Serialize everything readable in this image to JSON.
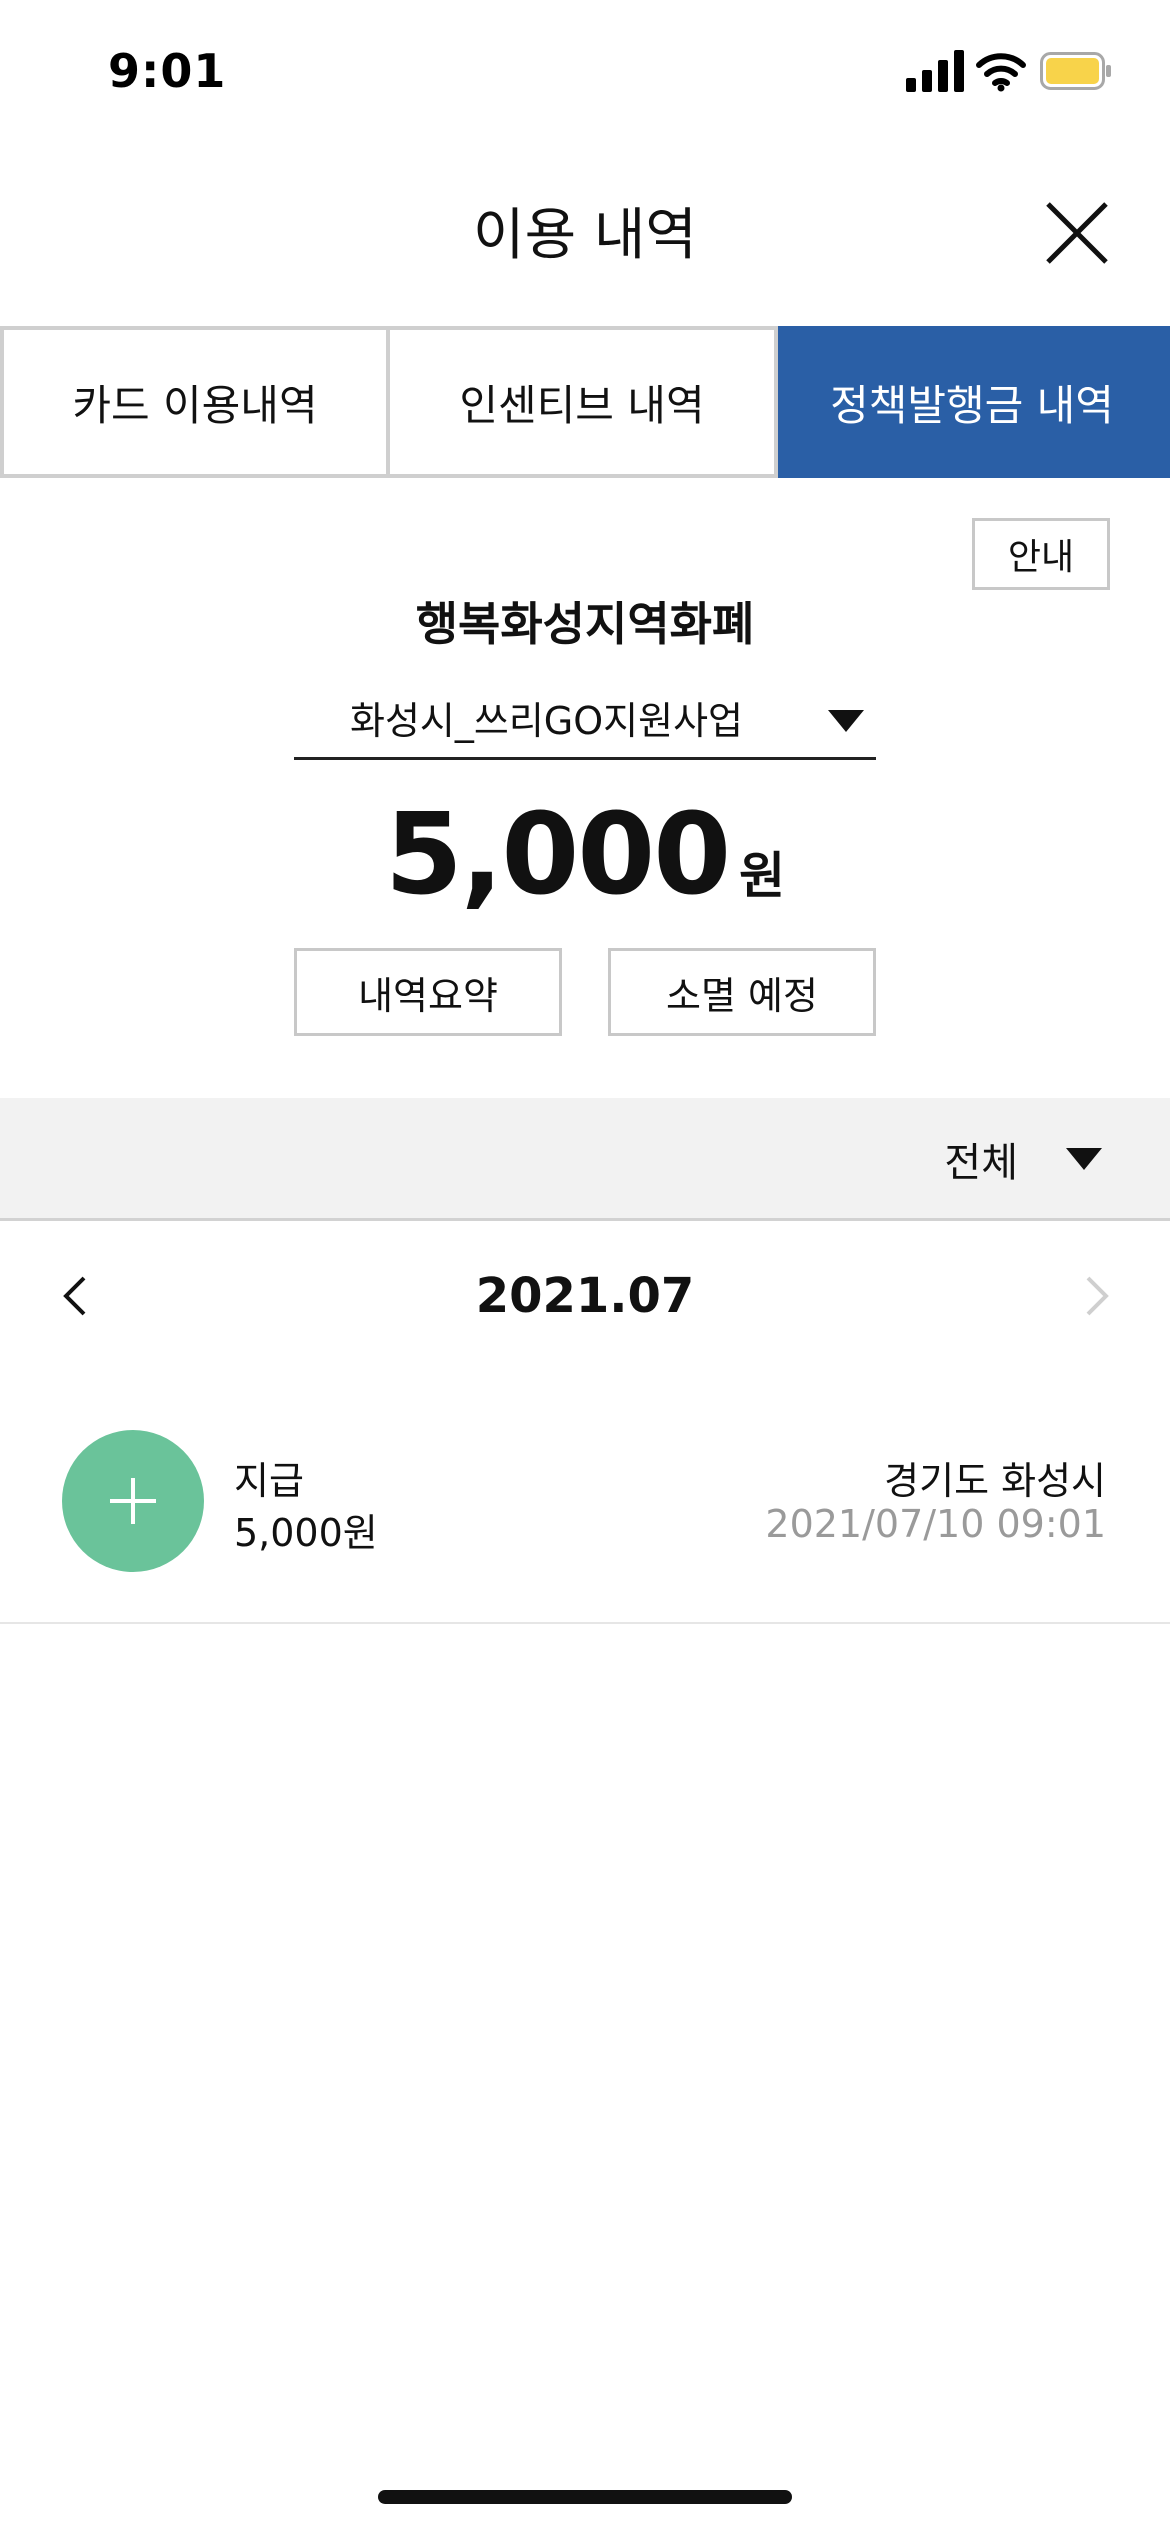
{
  "status_bar": {
    "time": "9:01",
    "icons": [
      "cellular-signal-icon",
      "wifi-icon",
      "battery-icon"
    ],
    "battery_color": "#f8d34a"
  },
  "header": {
    "title": "이용 내역",
    "close_icon": "close-icon"
  },
  "tabs": [
    {
      "label": "카드 이용내역",
      "active": false
    },
    {
      "label": "인센티브 내역",
      "active": false
    },
    {
      "label": "정책발행금 내역",
      "active": true
    }
  ],
  "summary": {
    "guide_label": "안내",
    "currency_name": "행복화성지역화폐",
    "program_selected": "화성시_쓰리GO지원사업",
    "amount": "5,000",
    "amount_unit": "원",
    "summary_button": "내역요약",
    "expiry_button": "소멸 예정"
  },
  "filter": {
    "selected": "전체"
  },
  "month_nav": {
    "label": "2021.07"
  },
  "transactions": [
    {
      "type": "지급",
      "amount": "5,000원",
      "place": "경기도 화성시",
      "datetime": "2021/07/10 09:01",
      "icon": "plus-icon",
      "icon_color": "#6ac39a"
    }
  ],
  "colors": {
    "active_tab": "#2a5fa6",
    "filter_bar": "#f2f2f2",
    "muted_text": "#9a9a9a"
  }
}
